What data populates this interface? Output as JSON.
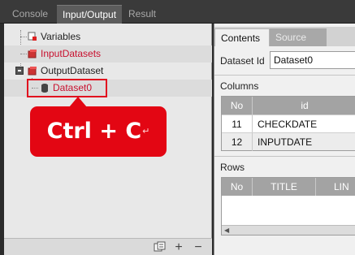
{
  "top_tabs": [
    {
      "label": "Console",
      "active": false
    },
    {
      "label": "Input/Output",
      "active": true
    },
    {
      "label": "Result",
      "active": false
    }
  ],
  "tree": {
    "variables": "Variables",
    "input_datasets": "InputDatasets",
    "output_dataset": "OutputDataset",
    "dataset0": "Dataset0"
  },
  "callout": {
    "text": "Ctrl + C",
    "enter_glyph": "↵"
  },
  "left_toolbar": {
    "settings_icon": "settings-icon",
    "add": "+",
    "remove": "−"
  },
  "right_tabs": [
    {
      "label": "Contents",
      "active": true
    },
    {
      "label": "Source",
      "active": false
    }
  ],
  "dataset_id": {
    "label": "Dataset Id",
    "value": "Dataset0"
  },
  "columns": {
    "title": "Columns",
    "headers": [
      "No",
      "id"
    ],
    "rows": [
      {
        "no": "11",
        "id": "CHECKDATE"
      },
      {
        "no": "12",
        "id": "INPUTDATE"
      }
    ]
  },
  "rows_section": {
    "title": "Rows",
    "headers": [
      "No",
      "TITLE",
      "LIN"
    ]
  },
  "colors": {
    "accent_red": "#e30613",
    "tree_red": "#c8102e",
    "header_gray": "#a3a3a3"
  }
}
